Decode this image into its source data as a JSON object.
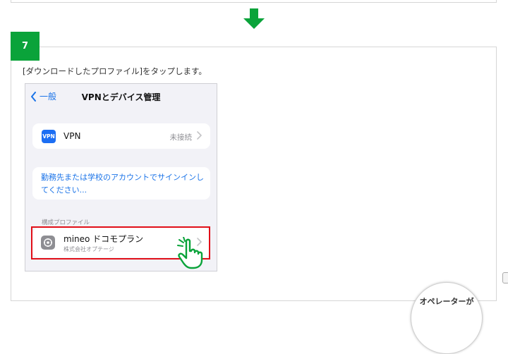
{
  "step": {
    "number": "7",
    "instruction": "[ダウンロードしたプロファイル]をタップします。"
  },
  "phone": {
    "nav": {
      "back_label": "一般",
      "title": "VPNとデバイス管理"
    },
    "vpn_row": {
      "badge": "VPN",
      "label": "VPN",
      "status": "未接続"
    },
    "signin_link": "勤務先または学校のアカウントでサインインしてください...",
    "profiles_header": "構成プロファイル",
    "profile": {
      "name": "mineo ドコモプラン",
      "organization": "株式会社オプテージ"
    }
  },
  "operator_badge": {
    "text": "オペレーターが"
  },
  "colors": {
    "accent_green": "#0aa33a",
    "highlight_red": "#e10f18",
    "ios_blue": "#1a73e8",
    "ios_bg": "#f2f2f7"
  }
}
